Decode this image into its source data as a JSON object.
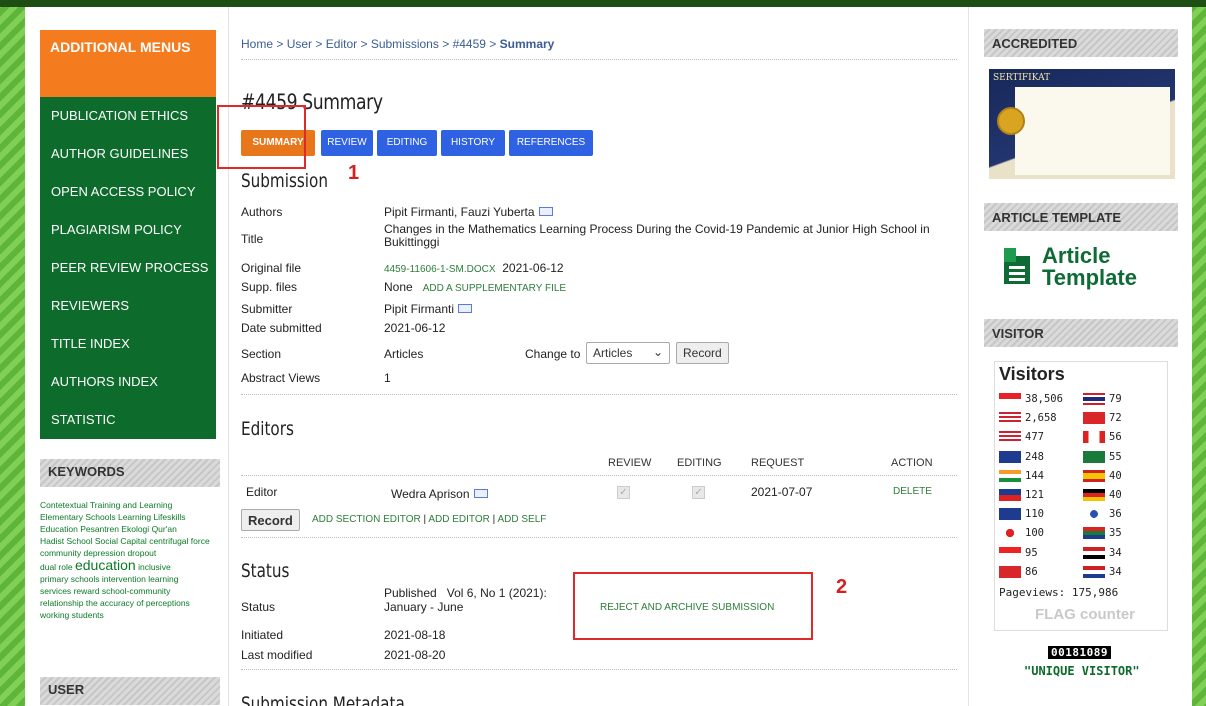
{
  "breadcrumb": {
    "home": "Home",
    "user": "User",
    "editor": "Editor",
    "submissions": "Submissions",
    "id": "#4459",
    "current": "Summary",
    "sep": ">"
  },
  "page_title": "#4459 Summary",
  "tabs": [
    "SUMMARY",
    "REVIEW",
    "EDITING",
    "HISTORY",
    "REFERENCES"
  ],
  "annotations": {
    "one": "1",
    "two": "2"
  },
  "submission": {
    "heading": "Submission",
    "authors_label": "Authors",
    "authors": "Pipit Firmanti, Fauzi Yuberta",
    "title_label": "Title",
    "title": "Changes in the Mathematics Learning Process During the Covid-19 Pandemic at Junior High School in Bukittinggi",
    "original_label": "Original file",
    "original_file": "4459-11606-1-SM.DOCX",
    "original_date": "2021-06-12",
    "supp_label": "Supp. files",
    "supp_value": "None",
    "supp_link": "ADD A SUPPLEMENTARY FILE",
    "submitter_label": "Submitter",
    "submitter": "Pipit Firmanti",
    "date_label": "Date submitted",
    "date": "2021-06-12",
    "section_label": "Section",
    "section": "Articles",
    "change_to": "Change to",
    "section_select": "Articles",
    "record": "Record",
    "views_label": "Abstract Views",
    "views": "1"
  },
  "editors": {
    "heading": "Editors",
    "cols": {
      "review": "REVIEW",
      "editing": "EDITING",
      "request": "REQUEST",
      "action": "ACTION"
    },
    "row": {
      "role": "Editor",
      "name": "Wedra Aprison",
      "request": "2021-07-07",
      "action": "DELETE"
    },
    "record": "Record",
    "add_section": "ADD SECTION EDITOR",
    "add_editor": "ADD EDITOR",
    "add_self": "ADD SELF",
    "divider": "|"
  },
  "status": {
    "heading": "Status",
    "status_label": "Status",
    "status_value": "Published",
    "issue_line1": "Vol 6, No 1 (2021):",
    "issue_line2": "January - June",
    "reject": "REJECT AND ARCHIVE SUBMISSION",
    "initiated_label": "Initiated",
    "initiated": "2021-08-18",
    "modified_label": "Last modified",
    "modified": "2021-08-20"
  },
  "metadata_heading": "Submission Metadata",
  "left": {
    "menu_title": "ADDITIONAL MENUS",
    "menu": [
      "PUBLICATION ETHICS",
      "AUTHOR GUIDELINES",
      "OPEN ACCESS POLICY",
      "PLAGIARISM POLICY",
      "PEER REVIEW PROCESS",
      "REVIEWERS",
      "TITLE INDEX",
      "AUTHORS INDEX",
      "STATISTIC"
    ],
    "keywords_heading": "KEYWORDS",
    "keywords": [
      "Contetextual Training and Learning",
      "Elementary Schools",
      "Learning",
      "Lifeskills",
      "Education",
      "Pesantren Ekologi",
      "Qur'an",
      "Hadist",
      "School",
      "Social Capital",
      "centrifugal force",
      "community",
      "depression",
      "dropout",
      "dual role",
      "education",
      "inclusive",
      "primary schools",
      "intervention",
      "learning",
      "services",
      "reward",
      "school-community",
      "relationship",
      "the accuracy of perceptions",
      "working students"
    ],
    "user_heading": "USER"
  },
  "right": {
    "accredited": "ACCREDITED",
    "cert_label": "SERTIFIKAT",
    "template_heading": "ARTICLE TEMPLATE",
    "template_line1": "Article",
    "template_line2": "Template",
    "visitor_heading": "VISITOR",
    "visitors_title": "Visitors",
    "visitors_left": [
      {
        "n": "38,506",
        "c": "id"
      },
      {
        "n": "2,658",
        "c": "us"
      },
      {
        "n": "477",
        "c": "my"
      },
      {
        "n": "248",
        "c": "au"
      },
      {
        "n": "144",
        "c": "in"
      },
      {
        "n": "121",
        "c": "ph"
      },
      {
        "n": "110",
        "c": "gb"
      },
      {
        "n": "100",
        "c": "jp"
      },
      {
        "n": "95",
        "c": "sg"
      },
      {
        "n": "86",
        "c": "cn"
      }
    ],
    "visitors_right": [
      {
        "n": "79",
        "c": "th"
      },
      {
        "n": "72",
        "c": "tr"
      },
      {
        "n": "56",
        "c": "ca"
      },
      {
        "n": "55",
        "c": "sa"
      },
      {
        "n": "40",
        "c": "es"
      },
      {
        "n": "40",
        "c": "de"
      },
      {
        "n": "36",
        "c": "kr"
      },
      {
        "n": "35",
        "c": "za"
      },
      {
        "n": "34",
        "c": "eg"
      },
      {
        "n": "34",
        "c": "nl"
      }
    ],
    "pageviews": "Pageviews: 175,986",
    "flagcounter": "FLAG counter",
    "counter": "00181089",
    "unique": "\"UNIQUE VISITOR\""
  }
}
